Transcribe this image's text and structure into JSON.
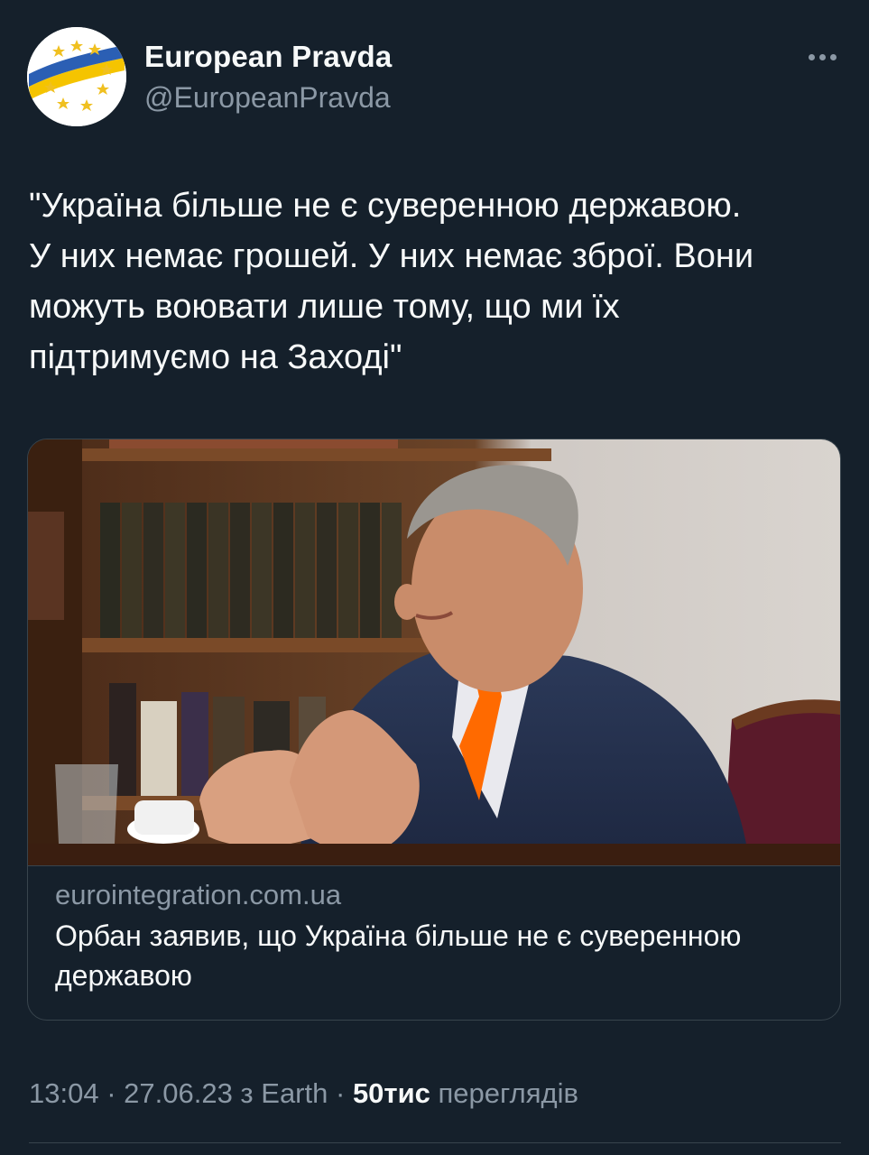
{
  "author": {
    "display_name": "European Pravda",
    "handle": "@EuropeanPravda",
    "avatar_icon": "european-pravda-logo",
    "avatar_colors": {
      "blue": "#2b5fb4",
      "yellow": "#f5c400",
      "star": "#f0c020"
    }
  },
  "more_icon": "more-horizontal-icon",
  "tweet": {
    "text": "\"Україна більше не є суверенною державою.\nУ них немає грошей. У них немає зброї. Вони\nможуть воювати лише тому, що ми їх\nпідтримуємо на Заході\""
  },
  "card": {
    "image_icon": "photo-of-speaker",
    "domain": "eurointegration.com.ua",
    "title": "Орбан заявив, що Україна більше не є суверенною державою"
  },
  "footer": {
    "time": "13:04",
    "sep1": " · ",
    "date": "27.06.23",
    "source_prefix": " з ",
    "source": "Earth",
    "sep2": " · ",
    "views_count": "50тис",
    "views_label": " переглядів"
  },
  "colors": {
    "background": "#15202b",
    "primary_text": "#f7f9f9",
    "secondary_text": "#8b98a5",
    "border": "#38444d"
  }
}
